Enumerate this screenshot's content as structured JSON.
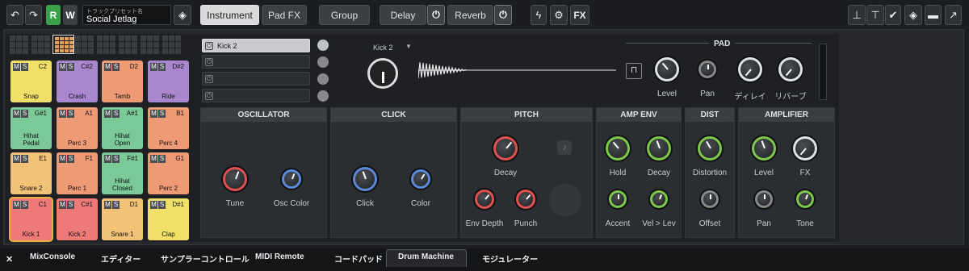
{
  "toolbar": {
    "read": "R",
    "write": "W",
    "preset_caption": "トラックプリセット名",
    "preset_name": "Social Jetlag",
    "instrument": "Instrument",
    "padfx": "Pad FX",
    "group": "Group",
    "delay": "Delay",
    "reverb": "Reverb",
    "fx": "FX"
  },
  "pads": [
    {
      "note": "C2",
      "name": "Snap",
      "color": "#f0e068"
    },
    {
      "note": "C#2",
      "name": "Crash",
      "color": "#a887cf"
    },
    {
      "note": "D2",
      "name": "Tamb",
      "color": "#ee9a74"
    },
    {
      "note": "D#2",
      "name": "Ride",
      "color": "#a887cf"
    },
    {
      "note": "G#1",
      "name": "Hihat\nPedal",
      "color": "#7cc998"
    },
    {
      "note": "A1",
      "name": "Perc 3",
      "color": "#ee9a74"
    },
    {
      "note": "A#1",
      "name": "Hihat\nOpen",
      "color": "#7cc998"
    },
    {
      "note": "B1",
      "name": "Perc 4",
      "color": "#ee9a74"
    },
    {
      "note": "E1",
      "name": "Snare 2",
      "color": "#f2c376"
    },
    {
      "note": "F1",
      "name": "Perc 1",
      "color": "#ee9a74"
    },
    {
      "note": "F#1",
      "name": "Hihat\nClosed",
      "color": "#7cc998"
    },
    {
      "note": "G1",
      "name": "Perc 2",
      "color": "#ee9a74"
    },
    {
      "note": "C1",
      "name": "Kick 1",
      "color": "#ee7a78"
    },
    {
      "note": "C#1",
      "name": "Kick 2",
      "color": "#ee7a78"
    },
    {
      "note": "D1",
      "name": "Snare 1",
      "color": "#f2c376"
    },
    {
      "note": "D#1",
      "name": "Clap",
      "color": "#f0e068"
    }
  ],
  "ms": {
    "m": "M",
    "s": "S"
  },
  "layers": {
    "first": "Kick 2"
  },
  "sample": {
    "name": "Kick 2"
  },
  "pad_section": {
    "title": "PAD",
    "level": "Level",
    "pan": "Pan",
    "delay": "ディレイ",
    "reverb": "リバーブ"
  },
  "osc": {
    "title": "OSCILLATOR",
    "tune": "Tune",
    "osc_color": "Osc Color"
  },
  "click": {
    "title": "CLICK",
    "click": "Click",
    "color": "Color"
  },
  "pitch": {
    "title": "PITCH",
    "decay": "Decay",
    "env_depth": "Env Depth",
    "punch": "Punch"
  },
  "ampenv": {
    "title": "AMP ENV",
    "hold": "Hold",
    "decay": "Decay",
    "accent": "Accent",
    "vel": "Vel > Lev"
  },
  "dist": {
    "title": "DIST",
    "distortion": "Distortion",
    "offset": "Offset"
  },
  "amplifier": {
    "title": "AMPLIFIER",
    "level": "Level",
    "fx": "FX",
    "pan": "Pan",
    "tone": "Tone"
  },
  "tabs": [
    "MixConsole",
    "エディター",
    "サンプラーコントロール",
    "MIDI Remote",
    "コードパッド",
    "Drum Machine",
    "モジュレーター"
  ],
  "close": "✕"
}
